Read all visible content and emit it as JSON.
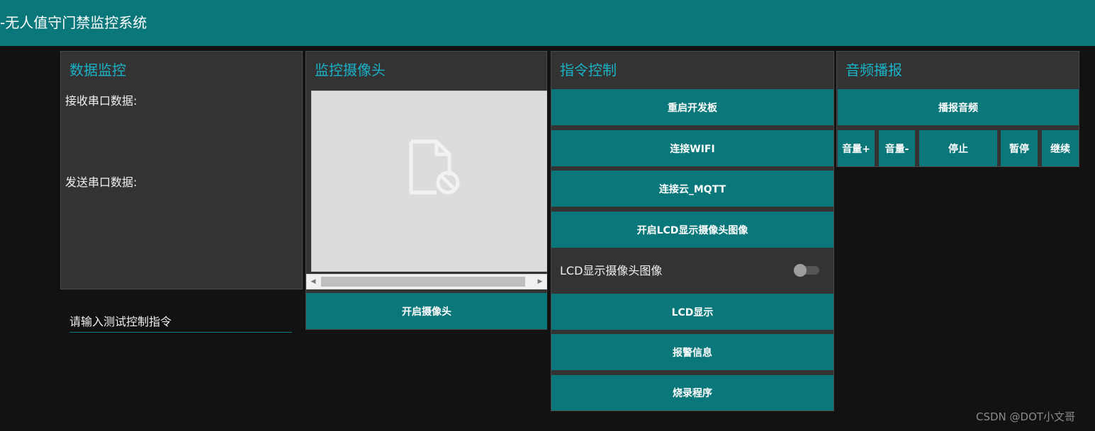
{
  "header": {
    "title": "-无人值守门禁监控系统"
  },
  "data_monitor": {
    "title": "数据监控",
    "receive_label": "接收串口数据:",
    "send_label": "发送串口数据:",
    "command_input_placeholder": "请输入测试控制指令"
  },
  "camera": {
    "title": "监控摄像头",
    "view_icon": "broken-image-icon",
    "open_button": "开启摄像头"
  },
  "command_control": {
    "title": "指令控制",
    "buttons": {
      "restart_board": "重启开发板",
      "connect_wifi": "连接WIFI",
      "connect_mqtt": "连接云_MQTT",
      "open_lcd_camera": "开启LCD显示摄像头图像",
      "lcd_display": "LCD显示",
      "alarm_info": "报警信息",
      "flash_program": "烧录程序"
    },
    "toggle": {
      "label": "LCD显示摄像头图像",
      "state": "off"
    }
  },
  "audio": {
    "title": "音频播报",
    "buttons": {
      "play": "播报音频",
      "volume_up": "音量+",
      "volume_down": "音量-",
      "stop": "停止",
      "pause": "暂停",
      "resume": "继续"
    }
  },
  "watermark": "CSDN @DOT小文哥",
  "colors": {
    "accent": "#0a777a",
    "panel_title": "#1ab2c6",
    "panel_bg": "#333333",
    "page_bg": "#121212"
  }
}
